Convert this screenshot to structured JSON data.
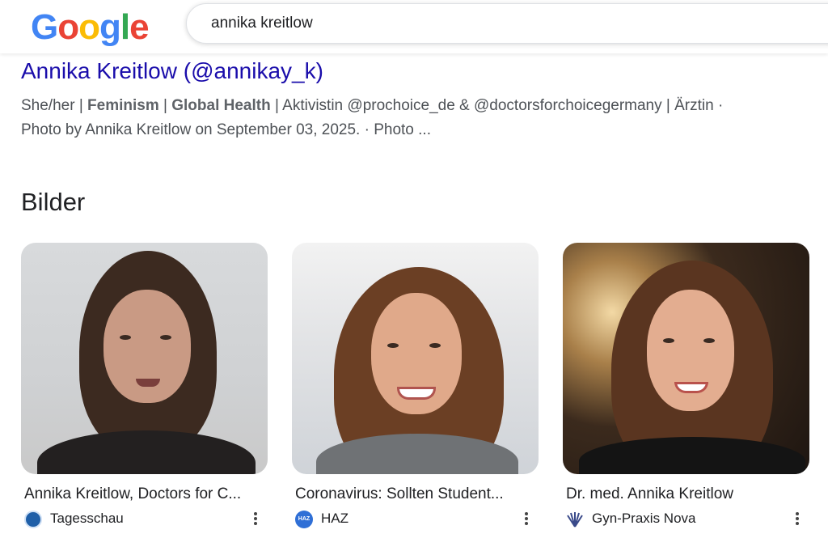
{
  "header": {
    "logo": [
      "G",
      "o",
      "o",
      "g",
      "l",
      "e"
    ],
    "logo_colors": [
      "#4285F4",
      "#EA4335",
      "#FBBC05",
      "#4285F4",
      "#34A853",
      "#EA4335"
    ],
    "search_query": "annika kreitlow"
  },
  "result": {
    "title": "Annika Kreitlow (@annikay_k)",
    "snippet_line1": {
      "part1": "She/her | ",
      "bold1": "Feminism",
      "part2": " | ",
      "bold2": "Global Health",
      "part3": " | Aktivistin @prochoice_de & @doctorsforchoicegermany | Ärztin ·"
    },
    "snippet_line2": "Photo by Annika Kreitlow on September 03, 2025. · Photo ..."
  },
  "images_section": {
    "heading": "Bilder",
    "cards": [
      {
        "caption": "Annika Kreitlow, Doctors for C...",
        "source": "Tagesschau",
        "favicon_color": "#1f5fa8",
        "favicon_label": ""
      },
      {
        "caption": "Coronavirus: Sollten Student...",
        "source": "HAZ",
        "favicon_color": "#2f6fd6",
        "favicon_label": "HAZ"
      },
      {
        "caption": "Dr. med. Annika Kreitlow",
        "source": "Gyn-Praxis Nova",
        "favicon_color": "#3a4a8a",
        "favicon_label": ""
      }
    ]
  }
}
